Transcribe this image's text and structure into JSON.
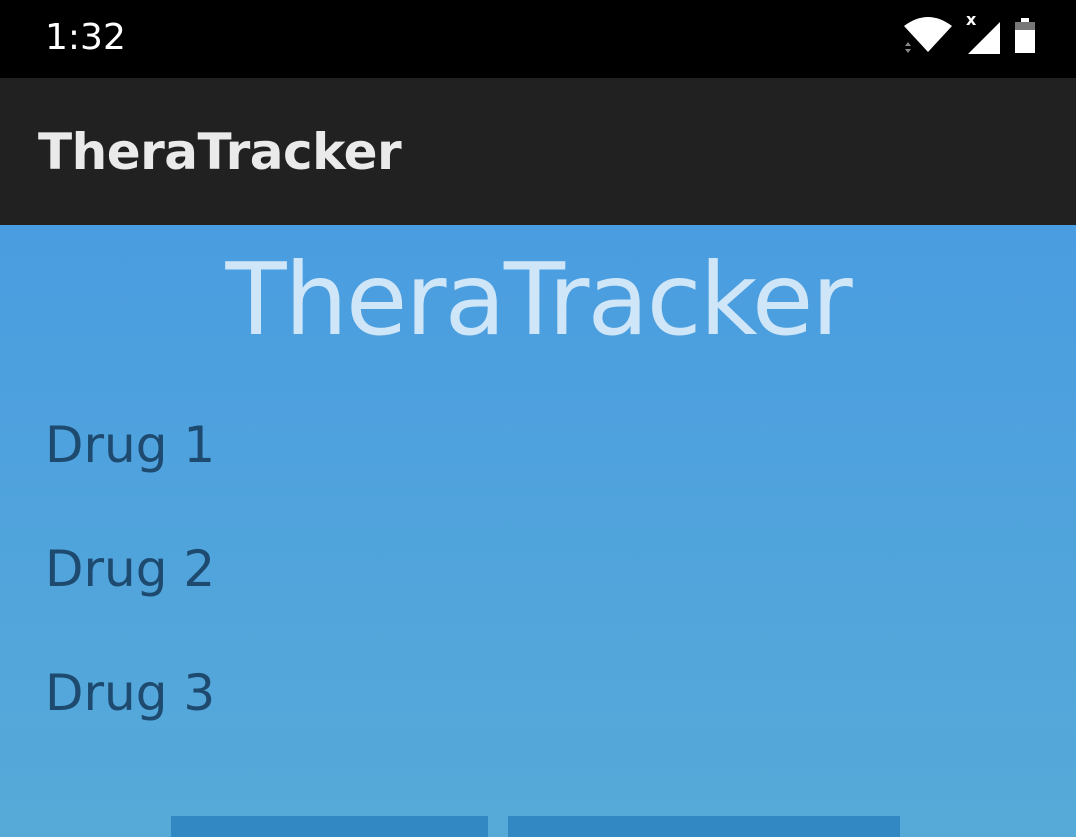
{
  "status_bar": {
    "time": "1:32",
    "network_indicator": "x",
    "icons": [
      "wifi-icon",
      "signal-icon",
      "battery-icon"
    ]
  },
  "app_bar": {
    "title": "TheraTracker"
  },
  "main": {
    "title": "TheraTracker",
    "drugs": [
      {
        "label": "Drug 1"
      },
      {
        "label": "Drug 2"
      },
      {
        "label": "Drug 3"
      }
    ]
  },
  "colors": {
    "status_bar": "#000000",
    "app_bar": "#212121",
    "content_top": "#4a9de0",
    "content_bottom": "#56aad8",
    "button": "#3288c3",
    "drug_text": "#1d4a6e",
    "hero_text": "#cfe6f8"
  }
}
